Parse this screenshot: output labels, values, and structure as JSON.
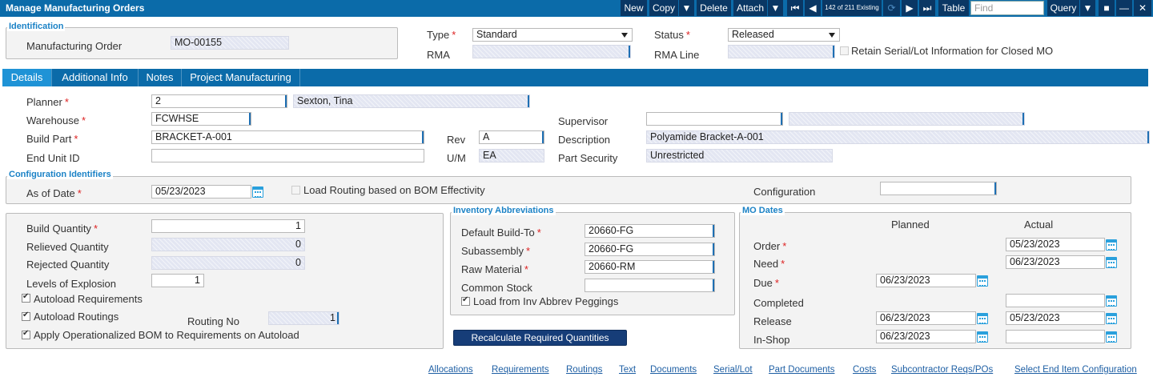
{
  "window": {
    "title": "Manage Manufacturing Orders"
  },
  "toolbar": {
    "new": "New",
    "copy": "Copy",
    "delete": "Delete",
    "attach": "Attach",
    "record_counter": "142 of 211 Existing",
    "table": "Table",
    "find_placeholder": "Find",
    "query": "Query"
  },
  "identification": {
    "group_label": "Identification",
    "mo_label": "Manufacturing Order",
    "mo_value": "MO-00155",
    "type_label": "Type",
    "type_value": "Standard",
    "status_label": "Status",
    "status_value": "Released",
    "rma_label": "RMA",
    "rma_line_label": "RMA Line",
    "retain_label": "Retain Serial/Lot Information for Closed MO"
  },
  "tabs": [
    "Details",
    "Additional Info",
    "Notes",
    "Project Manufacturing"
  ],
  "details": {
    "planner_label": "Planner",
    "planner_value": "2",
    "planner_name": "Sexton, Tina",
    "warehouse_label": "Warehouse",
    "warehouse_value": "FCWHSE",
    "supervisor_label": "Supervisor",
    "build_part_label": "Build Part",
    "build_part_value": "BRACKET-A-001",
    "rev_label": "Rev",
    "rev_value": "A",
    "description_label": "Description",
    "description_value": "Polyamide Bracket-A-001",
    "end_unit_label": "End Unit ID",
    "um_label": "U/M",
    "um_value": "EA",
    "part_security_label": "Part Security",
    "part_security_value": "Unrestricted"
  },
  "config": {
    "group_label": "Configuration Identifiers",
    "as_of_label": "As of Date",
    "as_of_value": "05/23/2023",
    "load_routing_label": "Load Routing based on BOM Effectivity",
    "configuration_label": "Configuration"
  },
  "quantities": {
    "build_qty_label": "Build Quantity",
    "build_qty": "1",
    "relieved_label": "Relieved Quantity",
    "relieved": "0",
    "rejected_label": "Rejected Quantity",
    "rejected": "0",
    "levels_label": "Levels of Explosion",
    "levels": "1",
    "autoload_req": "Autoload Requirements",
    "autoload_rout": "Autoload Routings",
    "routing_no_label": "Routing No",
    "routing_no": "1",
    "apply_bom": "Apply Operationalized BOM to Requirements on Autoload"
  },
  "inventory": {
    "group_label": "Inventory Abbreviations",
    "default_build_label": "Default Build-To",
    "default_build": "20660-FG",
    "subassembly_label": "Subassembly",
    "subassembly": "20660-FG",
    "raw_label": "Raw Material",
    "raw": "20660-RM",
    "common_label": "Common Stock",
    "load_label": "Load from Inv Abbrev Peggings"
  },
  "recalc_button": "Recalculate Required Quantities",
  "mo_dates": {
    "group_label": "MO Dates",
    "planned_hdr": "Planned",
    "actual_hdr": "Actual",
    "order_label": "Order",
    "order_actual": "05/23/2023",
    "need_label": "Need",
    "need_actual": "06/23/2023",
    "due_label": "Due",
    "due_planned": "06/23/2023",
    "completed_label": "Completed",
    "release_label": "Release",
    "release_planned": "06/23/2023",
    "release_actual": "05/23/2023",
    "inshop_label": "In-Shop",
    "inshop_planned": "06/23/2023"
  },
  "links": [
    "Allocations",
    "Requirements",
    "Routings",
    "Text",
    "Documents",
    "Serial/Lot",
    "Part Documents",
    "Costs",
    "Subcontractor Reqs/POs",
    "Select End Item Configuration"
  ]
}
